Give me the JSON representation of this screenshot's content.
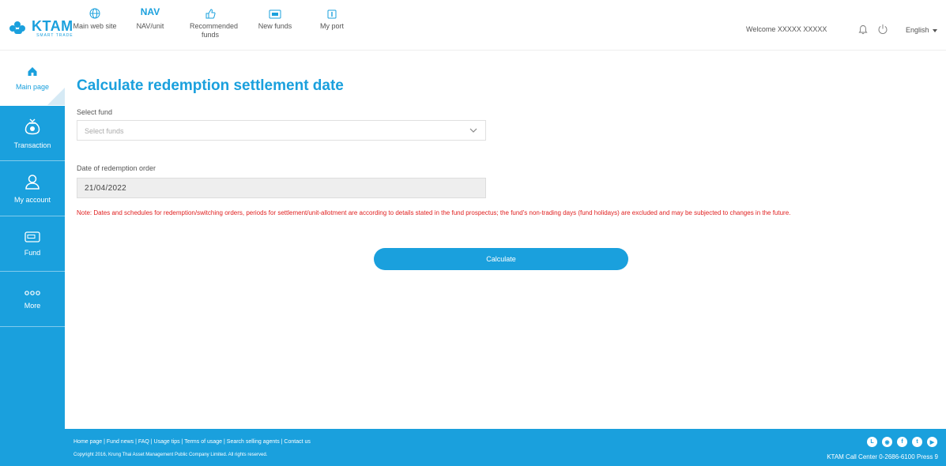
{
  "header": {
    "logo_text": "KTAM",
    "logo_subtext": "SMART TRADE",
    "nav": [
      {
        "label": "Main web site",
        "icon": "globe-icon"
      },
      {
        "label": "NAV/unit",
        "icon_text": "NAV"
      },
      {
        "label": "Recommended funds",
        "icon": "thumbs-up-icon"
      },
      {
        "label": "New funds",
        "icon": "new-badge-icon"
      },
      {
        "label": "My port",
        "icon": "portfolio-icon"
      }
    ],
    "welcome": "Welcome XXXXX XXXXX",
    "language": "English"
  },
  "sidebar": {
    "items": [
      {
        "label": "Main page",
        "icon": "home-icon",
        "active": true
      },
      {
        "label": "Transaction",
        "icon": "money-bag-icon",
        "active": false
      },
      {
        "label": "My account",
        "icon": "user-icon",
        "active": false
      },
      {
        "label": "Fund",
        "icon": "fund-card-icon",
        "active": false
      },
      {
        "label": "More",
        "icon": "more-dots-icon",
        "active": false
      }
    ]
  },
  "main": {
    "title": "Calculate redemption settlement date",
    "select_fund_label": "Select fund",
    "select_fund_placeholder": "Select funds",
    "date_label": "Date of redemption order",
    "date_value": "21/04/2022",
    "note": "Note: Dates and schedules for redemption/switching orders, periods for settlement/unit-allotment are according to details stated in the fund prospectus; the fund's non-trading days (fund holidays) are excluded and may be subjected to changes in the future.",
    "calculate_label": "Calculate"
  },
  "footer": {
    "links": "Home page | Fund news | FAQ | Usage tips | Terms of usage | Search selling agents | Contact us",
    "copyright": "Copyright 2016, Krung Thai Asset Management Public Company Limited. All rights reserved.",
    "call_center": "KTAM Call Center 0-2686-6100 Press 9",
    "social_icons": [
      "line-icon",
      "instagram-icon",
      "facebook-icon",
      "twitter-icon",
      "youtube-icon"
    ]
  },
  "colors": {
    "brand": "#1aa0dd",
    "note": "#e02020"
  }
}
